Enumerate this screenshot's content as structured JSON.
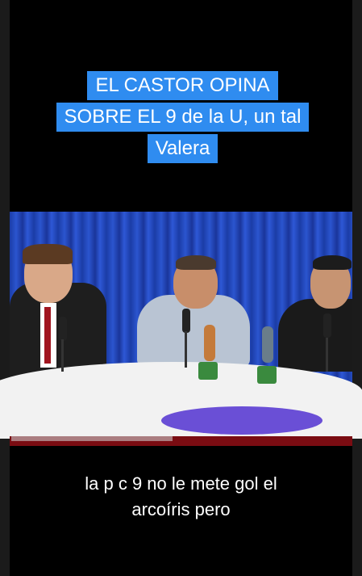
{
  "title_caption": {
    "line1": "EL CASTOR OPINA",
    "line2": "SOBRE EL 9 de la U, un tal",
    "line3": "Valera"
  },
  "subtitle": {
    "line1": "la p c 9 no le mete gol el",
    "line2": "arcoíris pero"
  },
  "colors": {
    "caption_bg": "#2f8cf0",
    "background": "#000000",
    "curtain": "#1d3fa8"
  }
}
